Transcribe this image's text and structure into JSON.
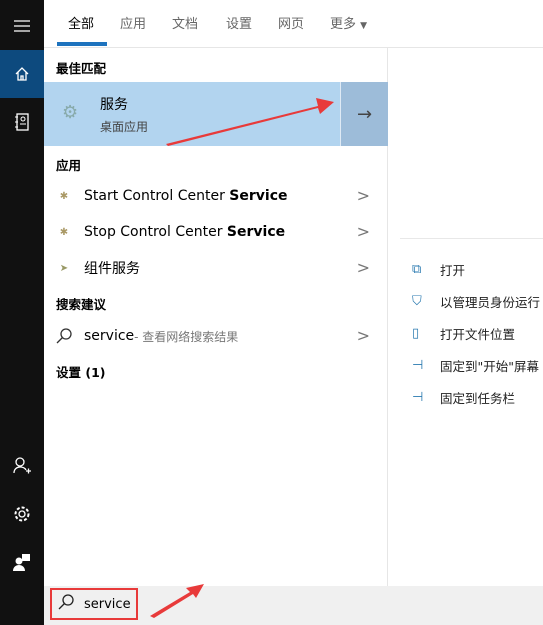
{
  "sidebar": {
    "items": [
      "menu-icon",
      "home-icon",
      "notebook-icon",
      "add-user-icon",
      "settings-icon",
      "feedback-icon"
    ]
  },
  "tabs": [
    {
      "label": "全部",
      "selected": true
    },
    {
      "label": "应用"
    },
    {
      "label": "文档"
    },
    {
      "label": "设置"
    },
    {
      "label": "网页"
    },
    {
      "label": "更多"
    }
  ],
  "best_match": {
    "section": "最佳匹配",
    "title": "服务",
    "subtitle": "桌面应用"
  },
  "apps": {
    "section": "应用",
    "items": [
      {
        "prefix": "Start Control Center ",
        "bold": "Service"
      },
      {
        "prefix": "Stop Control Center ",
        "bold": "Service"
      },
      {
        "prefix": "组件服务",
        "bold": ""
      }
    ]
  },
  "suggest": {
    "section": "搜索建议",
    "query": "service",
    "hint": " - 查看网络搜索结果"
  },
  "settings": {
    "section": "设置 (1)"
  },
  "actions": [
    "打开",
    "以管理员身份运行",
    "打开文件位置",
    "固定到\"开始\"屏幕",
    "固定到任务栏"
  ],
  "search": {
    "value": "service"
  },
  "colors": {
    "accent": "#1e73be",
    "highlight": "#b2d4ef",
    "annotation": "#e83a3a"
  }
}
